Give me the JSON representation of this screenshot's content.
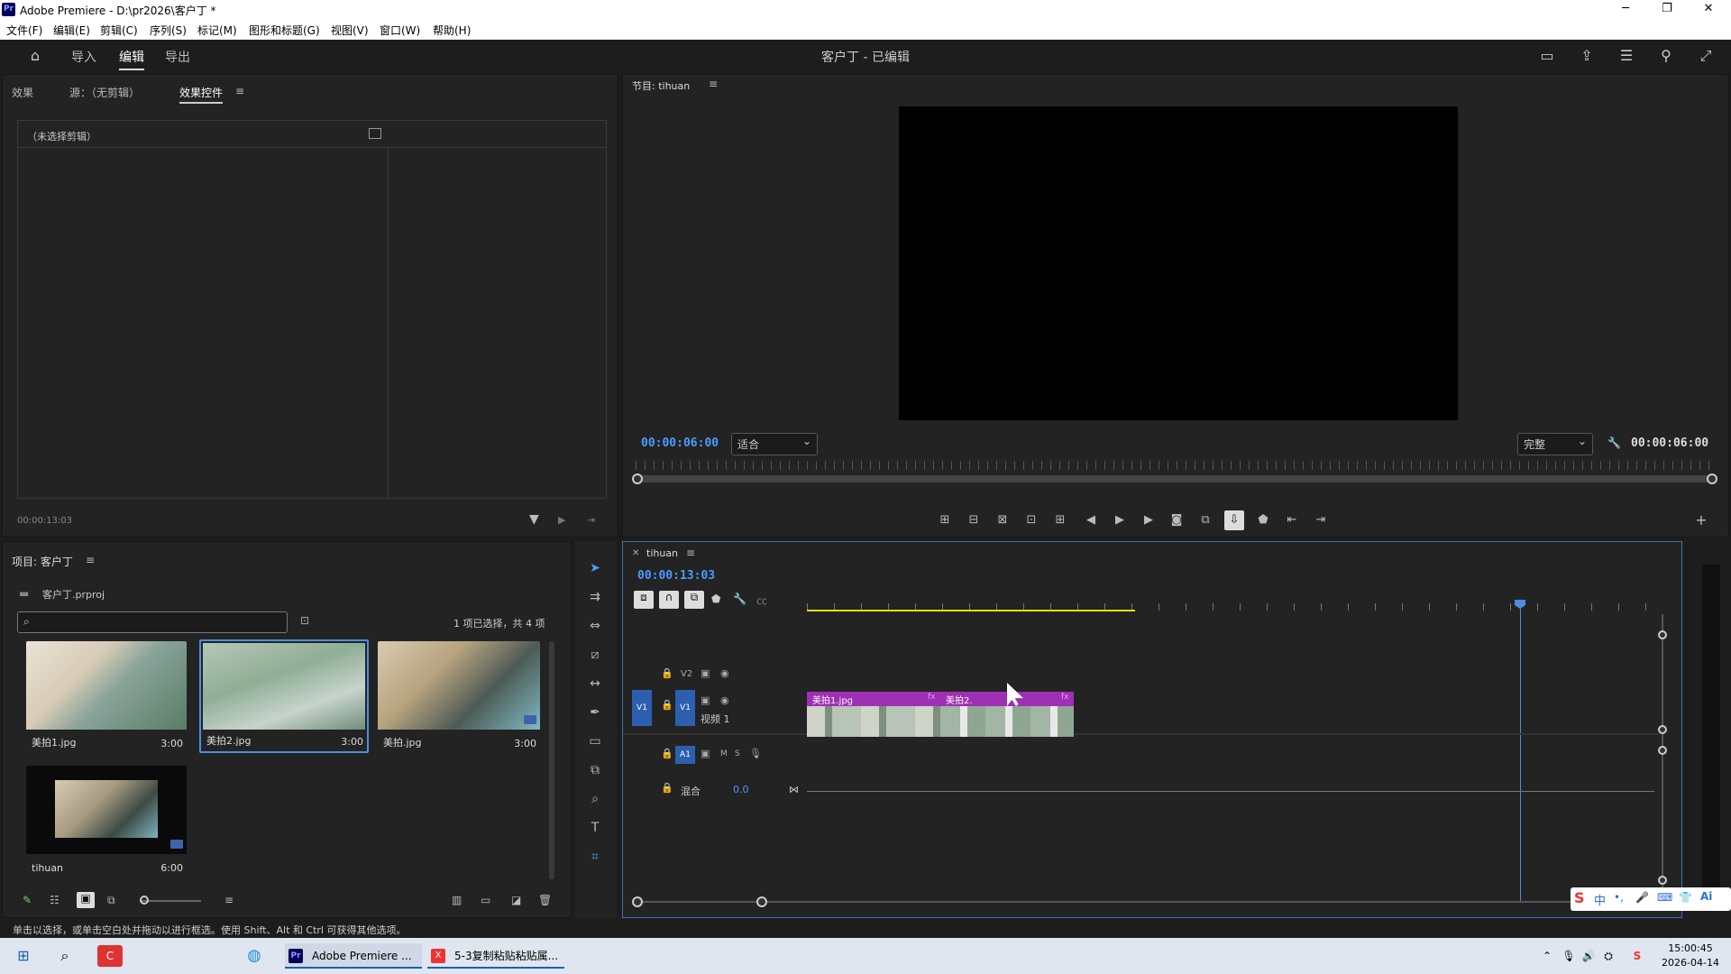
{
  "window": {
    "title": "Adobe Premiere - D:\\pr2026\\客户丁 *",
    "logo": "Pr"
  },
  "menu": [
    "文件(F)",
    "编辑(E)",
    "剪辑(C)",
    "序列(S)",
    "标记(M)",
    "图形和标题(G)",
    "视图(V)",
    "窗口(W)",
    "帮助(H)"
  ],
  "topnav": {
    "tabs": [
      "导入",
      "编辑",
      "导出"
    ],
    "active_tab": "编辑",
    "project_title": "客户丁 - 已编辑"
  },
  "effect_controls": {
    "tabs": [
      "效果",
      "源：（无剪辑）",
      "效果控件"
    ],
    "no_clip": "（未选择剪辑）",
    "timecode": "00:00:13:03"
  },
  "program": {
    "title": "节目: tihuan",
    "timecode_left": "00:00:06:00",
    "fit": "适合",
    "quality": "完整",
    "timecode_right": "00:00:06:00"
  },
  "project": {
    "title": "项目: 客户丁",
    "file": "客户丁.prproj",
    "search_placeholder": "",
    "selection": "1 项已选择，共 4 项",
    "items": [
      {
        "name": "美拍1.jpg",
        "duration": "3:00"
      },
      {
        "name": "美拍2.jpg",
        "duration": "3:00"
      },
      {
        "name": "美拍.jpg",
        "duration": "3:00"
      },
      {
        "name": "tihuan",
        "duration": "6:00"
      }
    ]
  },
  "timeline": {
    "sequence": "tihuan",
    "timecode": "00:00:13:03",
    "tracks": {
      "v2": "V2",
      "v1": "V1",
      "v1_name": "视频 1",
      "a1": "A1",
      "m": "M",
      "s": "S",
      "mix": "混合",
      "mix_value": "0.0"
    },
    "clips": [
      {
        "label": "美拍1.jpg"
      },
      {
        "label": "美拍2."
      }
    ]
  },
  "status_bar": "单击以选择，或单击空白处并拖动以进行框选。使用 Shift、Alt 和 Ctrl 可获得其他选项。",
  "taskbar": {
    "apps": [
      "Adobe Premiere ...",
      "5-3复制粘贴粘贴属..."
    ],
    "time": "15:00:45",
    "date": "2026-04-14",
    "ime": "中"
  }
}
